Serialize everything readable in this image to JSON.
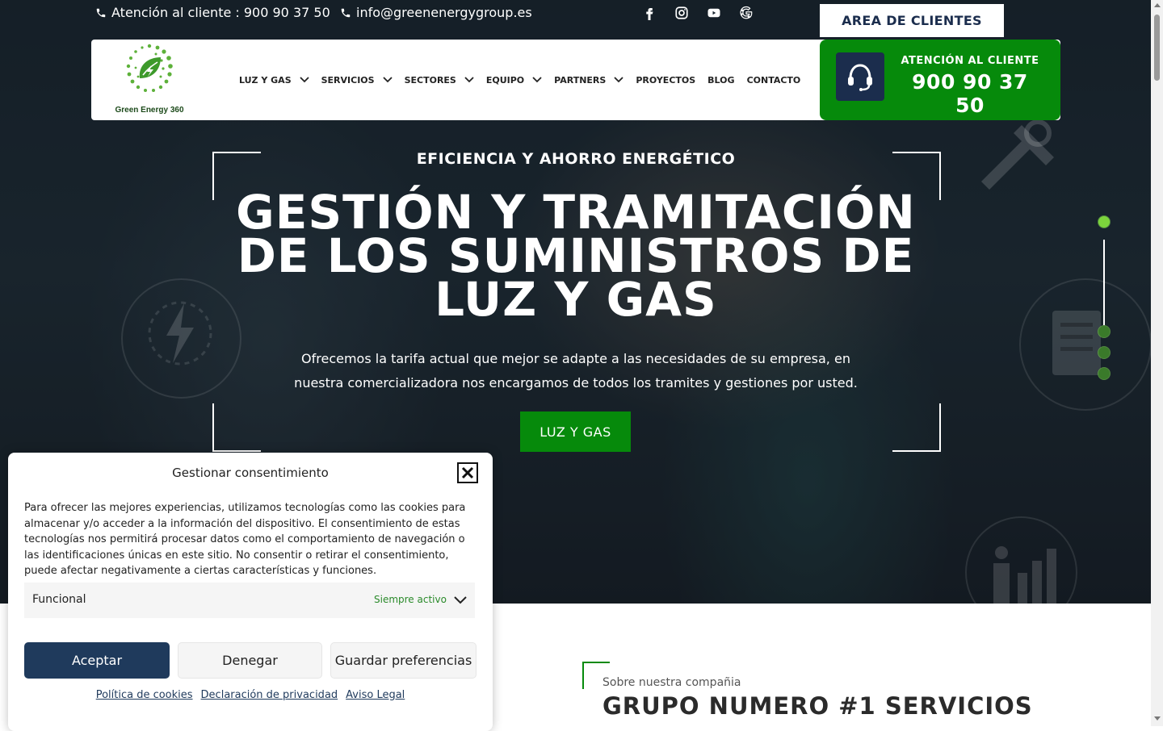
{
  "topbar": {
    "phone_text": "Atención al cliente : 900 90 37 50",
    "email_text": "info@greenenergygroup.es",
    "socials": [
      "facebook-icon",
      "instagram-icon",
      "youtube-icon",
      "google-icon"
    ],
    "area_button": "AREA DE CLIENTES"
  },
  "header": {
    "logo_text": "Green Energy 360",
    "nav": [
      {
        "label": "LUZ Y GAS",
        "dropdown": true
      },
      {
        "label": "SERVICIOS",
        "dropdown": true
      },
      {
        "label": "SECTORES",
        "dropdown": true
      },
      {
        "label": "EQUIPO",
        "dropdown": true
      },
      {
        "label": "PARTNERS",
        "dropdown": true
      },
      {
        "label": "PROYECTOS",
        "dropdown": false
      },
      {
        "label": "BLOG",
        "dropdown": false
      },
      {
        "label": "CONTACTO",
        "dropdown": false
      }
    ],
    "support_label": "ATENCIÓN AL CLIENTE",
    "support_phone": "900 90 37 50"
  },
  "hero": {
    "eyebrow": "EFICIENCIA Y AHORRO ENERGÉTICO",
    "title_lines": [
      "GESTIÓN Y TRAMITACIÓN",
      "DE LOS SUMINISTROS DE",
      "LUZ Y GAS"
    ],
    "description_lines": [
      "Ofrecemos la tarifa actual que mejor se adapte a las necesidades de su empresa, en",
      "nuestra comercializadora nos encargamos de todos los tramites y gestiones por usted."
    ],
    "cta": "LUZ Y GAS",
    "slides": 4,
    "active_slide": 1
  },
  "about": {
    "subtitle": "Sobre nuestra compañia",
    "title": "GRUPO NUMERO #1 SERVICIOS"
  },
  "consent": {
    "title": "Gestionar consentimiento",
    "text": "Para ofrecer las mejores experiencias, utilizamos tecnologías como las cookies para almacenar y/o acceder a la información del dispositivo. El consentimiento de estas tecnologías nos permitirá procesar datos como el comportamiento de navegación o las identificaciones únicas en este sitio. No consentir o retirar el consentimiento, puede afectar negativamente a ciertas características y funciones.",
    "category_label": "Funcional",
    "category_status": "Siempre activo",
    "accept": "Aceptar",
    "deny": "Denegar",
    "save": "Guardar preferencias",
    "links": [
      "Política de cookies",
      "Declaración de privacidad",
      "Aviso Legal"
    ]
  },
  "colors": {
    "brand_green": "#068a0b",
    "navy": "#1b2d4d",
    "accept_blue": "#1f3a5c",
    "dot_active": "#7cd43c"
  }
}
